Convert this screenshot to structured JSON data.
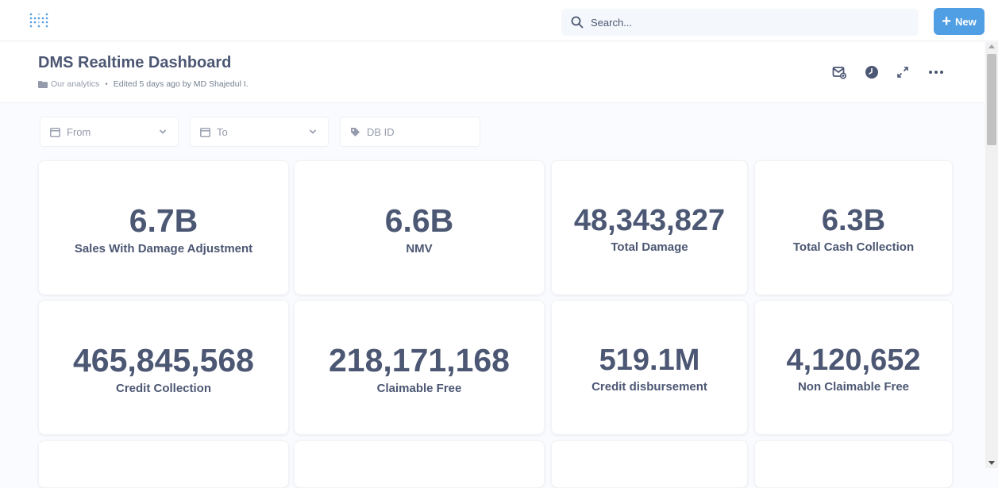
{
  "nav": {
    "search_placeholder": "Search...",
    "new_label": "New"
  },
  "header": {
    "title": "DMS Realtime Dashboard",
    "collection": "Our analytics",
    "separator": "•",
    "edited": "Edited 5 days ago by MD Shajedul I."
  },
  "filters": [
    {
      "label": "From",
      "icon": "calendar-icon",
      "has_dropdown": true
    },
    {
      "label": "To",
      "icon": "calendar-icon",
      "has_dropdown": true
    },
    {
      "label": "DB ID",
      "icon": "tag-icon",
      "has_dropdown": false
    }
  ],
  "cards": [
    {
      "value": "6.7B",
      "label": "Sales With Damage Adjustment"
    },
    {
      "value": "6.6B",
      "label": "NMV"
    },
    {
      "value": "48,343,827",
      "label": "Total Damage"
    },
    {
      "value": "6.3B",
      "label": "Total Cash Collection"
    },
    {
      "value": "465,845,568",
      "label": "Credit Collection"
    },
    {
      "value": "218,171,168",
      "label": "Claimable Free"
    },
    {
      "value": "519.1M",
      "label": "Credit disbursement"
    },
    {
      "value": "4,120,652",
      "label": "Non Claimable Free"
    }
  ],
  "colors": {
    "brand": "#509ee3",
    "text": "#4c5773",
    "muted": "#949aab",
    "background": "#f9fbfe"
  }
}
